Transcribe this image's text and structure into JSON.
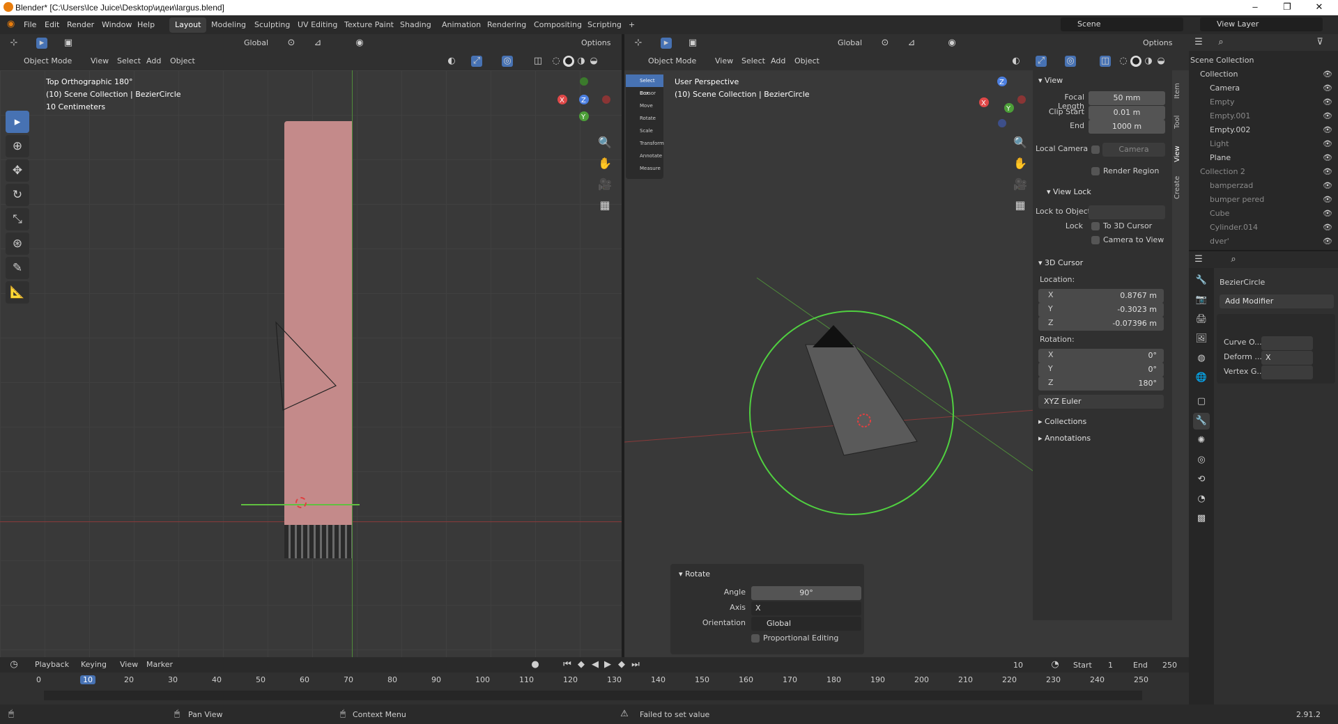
{
  "window": {
    "title": "Blender* [C:\\Users\\Ice Juice\\Desktop\\идеи\\largus.blend]",
    "minimize": "–",
    "maximize": "❐",
    "close": "✕"
  },
  "menu": {
    "items": [
      "File",
      "Edit",
      "Render",
      "Window",
      "Help"
    ]
  },
  "workspaces": {
    "tabs": [
      "Layout",
      "Modeling",
      "Sculpting",
      "UV Editing",
      "Texture Paint",
      "Shading",
      "Animation",
      "Rendering",
      "Compositing",
      "Scripting"
    ],
    "add": "+"
  },
  "scene": {
    "name": "Scene",
    "view_layer": "View Layer"
  },
  "left_viewport": {
    "transform": "Global",
    "options": "Options",
    "mode": "Object Mode",
    "menus": [
      "View",
      "Select",
      "Add",
      "Object"
    ],
    "overlay": {
      "view_name": "Top Orthographic 180°",
      "collection": "(10) Scene Collection | BezierCircle",
      "scale": "10 Centimeters"
    },
    "gizmo": {
      "x": "X",
      "y": "Y",
      "z": "Z"
    }
  },
  "right_viewport": {
    "transform": "Global",
    "options": "Options",
    "mode": "Object Mode",
    "menus": [
      "View",
      "Select",
      "Add",
      "Object"
    ],
    "overlay": {
      "view_name": "User Perspective",
      "collection": "(10) Scene Collection | BezierCircle"
    },
    "toolbar": [
      "Select Box",
      "Cursor",
      "Move",
      "Rotate",
      "Scale",
      "Transform",
      "Annotate",
      "Measure"
    ],
    "gizmo": {
      "x": "X",
      "y": "Y",
      "z": "Z"
    }
  },
  "npanel": {
    "tabs": [
      "Item",
      "Tool",
      "View",
      "Create"
    ],
    "view": {
      "header": "View",
      "focal_length_label": "Focal Length",
      "focal_length": "50 mm",
      "clip_start_label": "Clip Start",
      "clip_start": "0.01 m",
      "end_label": "End",
      "end": "1000 m",
      "local_camera_label": "Local Camera",
      "local_camera": "Camera",
      "render_region": "Render Region"
    },
    "view_lock": {
      "header": "View Lock",
      "lock_to_object_label": "Lock to Object",
      "lock_label": "Lock",
      "to_3d_cursor": "To 3D Cursor",
      "camera_to_view": "Camera to View"
    },
    "cursor": {
      "header": "3D Cursor",
      "location_label": "Location:",
      "x_label": "X",
      "x": "0.8767 m",
      "y_label": "Y",
      "y": "-0.3023 m",
      "z_label": "Z",
      "z": "-0.07396 m",
      "rotation_label": "Rotation:",
      "rx": "0°",
      "ry": "0°",
      "rz": "180°",
      "rotation_mode": "XYZ Euler"
    },
    "collections": "Collections",
    "annotations": "Annotations"
  },
  "operator": {
    "header": "Rotate",
    "angle_label": "Angle",
    "angle": "90°",
    "axis_label": "Axis",
    "axis": "X",
    "orientation_label": "Orientation",
    "orientation": "Global",
    "proportional": "Proportional Editing"
  },
  "outliner": {
    "root": "Scene Collection",
    "rows": [
      {
        "name": "Collection",
        "level": 0
      },
      {
        "name": "Camera",
        "level": 1
      },
      {
        "name": "Empty",
        "level": 1
      },
      {
        "name": "Empty.001",
        "level": 1
      },
      {
        "name": "Empty.002",
        "level": 1
      },
      {
        "name": "Light",
        "level": 1
      },
      {
        "name": "Plane",
        "level": 1
      },
      {
        "name": "Collection 2",
        "level": 0
      },
      {
        "name": "bamperzad",
        "level": 1
      },
      {
        "name": "bumper pered",
        "level": 1
      },
      {
        "name": "Cube",
        "level": 1
      },
      {
        "name": "Cylinder.014",
        "level": 1
      },
      {
        "name": "dver'",
        "level": 1
      }
    ]
  },
  "properties": {
    "object_name": "BezierCircle",
    "add_modifier": "Add Modifier",
    "curve_label": "Curve O...",
    "deform_label": "Deform ...",
    "deform_axis": "X",
    "vertex_group_label": "Vertex G..."
  },
  "timeline": {
    "menus": [
      "Playback",
      "Keying",
      "View",
      "Marker"
    ],
    "current_frame": "10",
    "start_label": "Start",
    "start": "1",
    "end_label": "End",
    "end": "250",
    "ticks": [
      "0",
      "10",
      "20",
      "30",
      "40",
      "50",
      "60",
      "70",
      "80",
      "90",
      "100",
      "110",
      "120",
      "130",
      "140",
      "150",
      "160",
      "170",
      "180",
      "190",
      "200",
      "210",
      "220",
      "230",
      "240",
      "250"
    ]
  },
  "status": {
    "left": "Pan View",
    "middle": "Context Menu",
    "warning": "Failed to set value",
    "version": "2.91.2"
  }
}
